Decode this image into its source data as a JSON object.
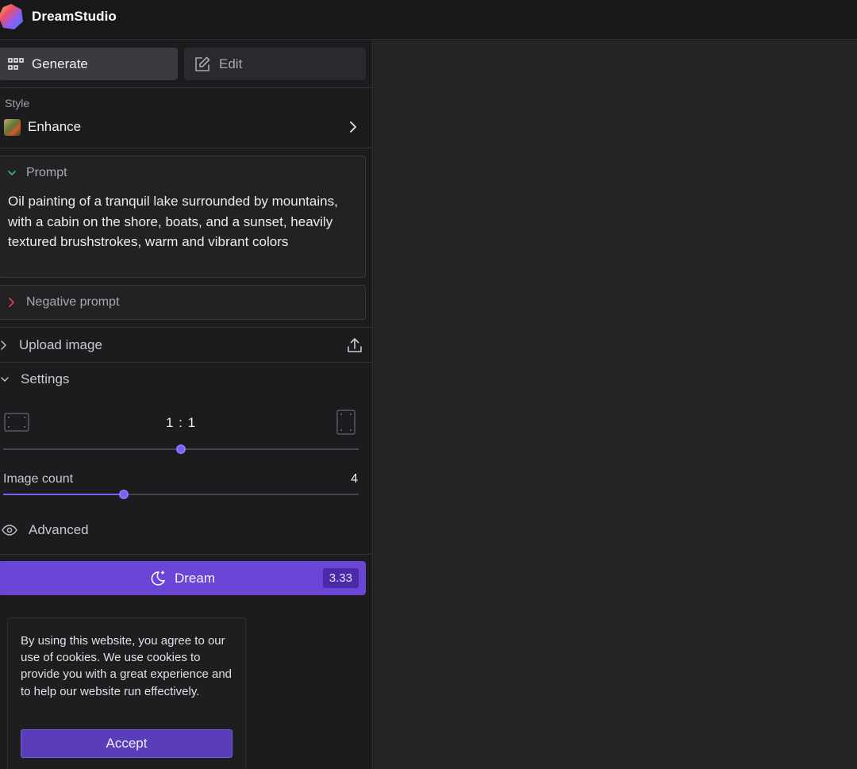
{
  "app": {
    "name": "DreamStudio"
  },
  "tabs": {
    "generate": "Generate",
    "edit": "Edit"
  },
  "style": {
    "label": "Style",
    "value": "Enhance"
  },
  "prompt": {
    "label": "Prompt",
    "text": "Oil painting of a tranquil lake surrounded by mountains, with a cabin on the shore, boats, and a sunset, heavily textured brushstrokes, warm and vibrant colors"
  },
  "negative_prompt": {
    "label": "Negative prompt"
  },
  "upload": {
    "label": "Upload image"
  },
  "settings": {
    "label": "Settings",
    "aspect_ratio": "1 : 1",
    "aspect_slider_position": 0.5,
    "image_count_label": "Image count",
    "image_count_value": "4",
    "image_count_slider_position": 0.34,
    "advanced_label": "Advanced"
  },
  "dream_button": {
    "label": "Dream",
    "cost": "3.33"
  },
  "cookie_banner": {
    "text": "By using this website, you agree to our use of cookies. We use cookies to provide you with a great experience and to help our website run effectively.",
    "accept_label": "Accept"
  },
  "colors": {
    "accent": "#6b46d6",
    "background": "#1d1d20",
    "prompt_chevron": "#3fb27f",
    "negative_chevron": "#e0454a"
  }
}
